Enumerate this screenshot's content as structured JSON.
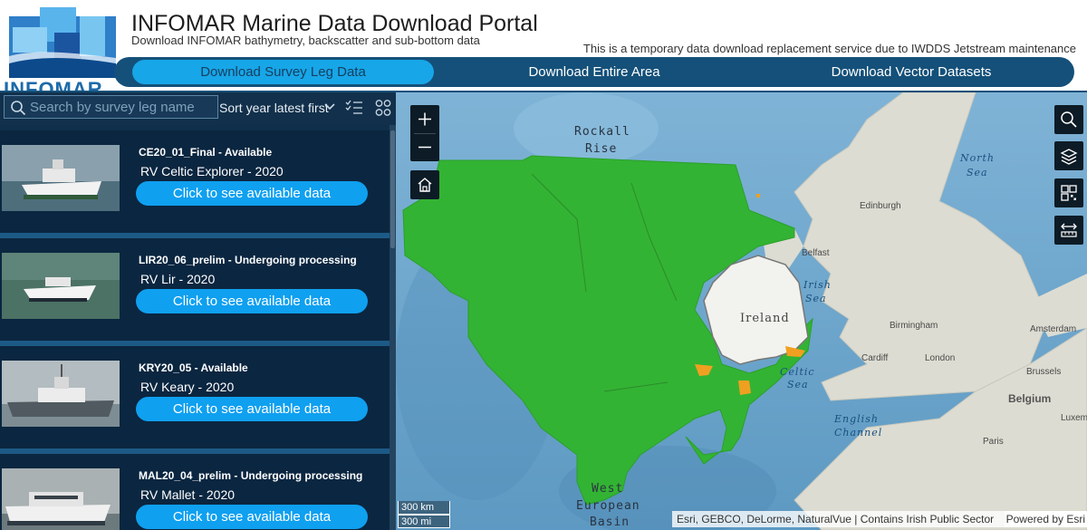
{
  "header": {
    "logo_text": "INFOMAR",
    "title": "INFOMAR Marine Data Download Portal",
    "subtitle": "Download INFOMAR bathymetry, backscatter and sub-bottom data",
    "notice": "This is a temporary data download replacement service due to IWDDS Jetstream maintenance",
    "nav": [
      {
        "label": "Download Survey Leg Data",
        "active": true
      },
      {
        "label": "Download Entire Area",
        "active": false
      },
      {
        "label": "Download Vector Datasets",
        "active": false
      }
    ]
  },
  "sidebar": {
    "search_placeholder": "Search by survey leg name",
    "sort_label": "Sort year latest first",
    "icons": [
      "search-icon",
      "chevron-down-icon",
      "filter-list-icon",
      "grid-icon"
    ],
    "items": [
      {
        "title": "CE20_01_Final  - Available",
        "vessel": "RV Celtic Explorer  - 2020",
        "button": "Click to see available data"
      },
      {
        "title": "LIR20_06_prelim  - Undergoing processing",
        "vessel": "RV Lir  - 2020",
        "button": "Click to see available data"
      },
      {
        "title": "KRY20_05  - Available",
        "vessel": "RV Keary  - 2020",
        "button": "Click to see available data"
      },
      {
        "title": "MAL20_04_prelim  - Undergoing processing",
        "vessel": "RV Mallet  - 2020",
        "button": "Click to see available data"
      }
    ]
  },
  "map": {
    "labels": {
      "rockall": "Rockall",
      "rise": "Rise",
      "north": "North",
      "sea": "Sea",
      "edinburgh": "Edinburgh",
      "belfast": "Belfast",
      "irish": "Irish",
      "irish_sea": "Sea",
      "ireland": "Ireland",
      "birmingham": "Birmingham",
      "amsterdam": "Amsterdam",
      "cardiff": "Cardiff",
      "london": "London",
      "brussels": "Brussels",
      "celtic": "Celtic",
      "celtic_sea": "Sea",
      "belgium": "Belgium",
      "lux": "Luxembo",
      "english": "English",
      "channel": "Channel",
      "paris": "Paris",
      "west": "West",
      "european": "European",
      "basin": "Basin"
    },
    "scale": [
      "300 km",
      "300 mi"
    ],
    "attribution": "Esri, GEBCO, DeLorme, NaturalVue | Contains Irish Public Sector ...",
    "powered_by": "Powered by Esri",
    "controls": [
      "zoom-in-icon",
      "zoom-out-icon",
      "home-icon",
      "search-icon",
      "layers-icon",
      "qr-code-icon",
      "measure-icon"
    ],
    "colors": {
      "sea": "#6aa6cc",
      "land": "#dcdcd2",
      "ireland": "#f2f2ee",
      "coverage": "#33b333",
      "processing": "#f0a020"
    }
  }
}
